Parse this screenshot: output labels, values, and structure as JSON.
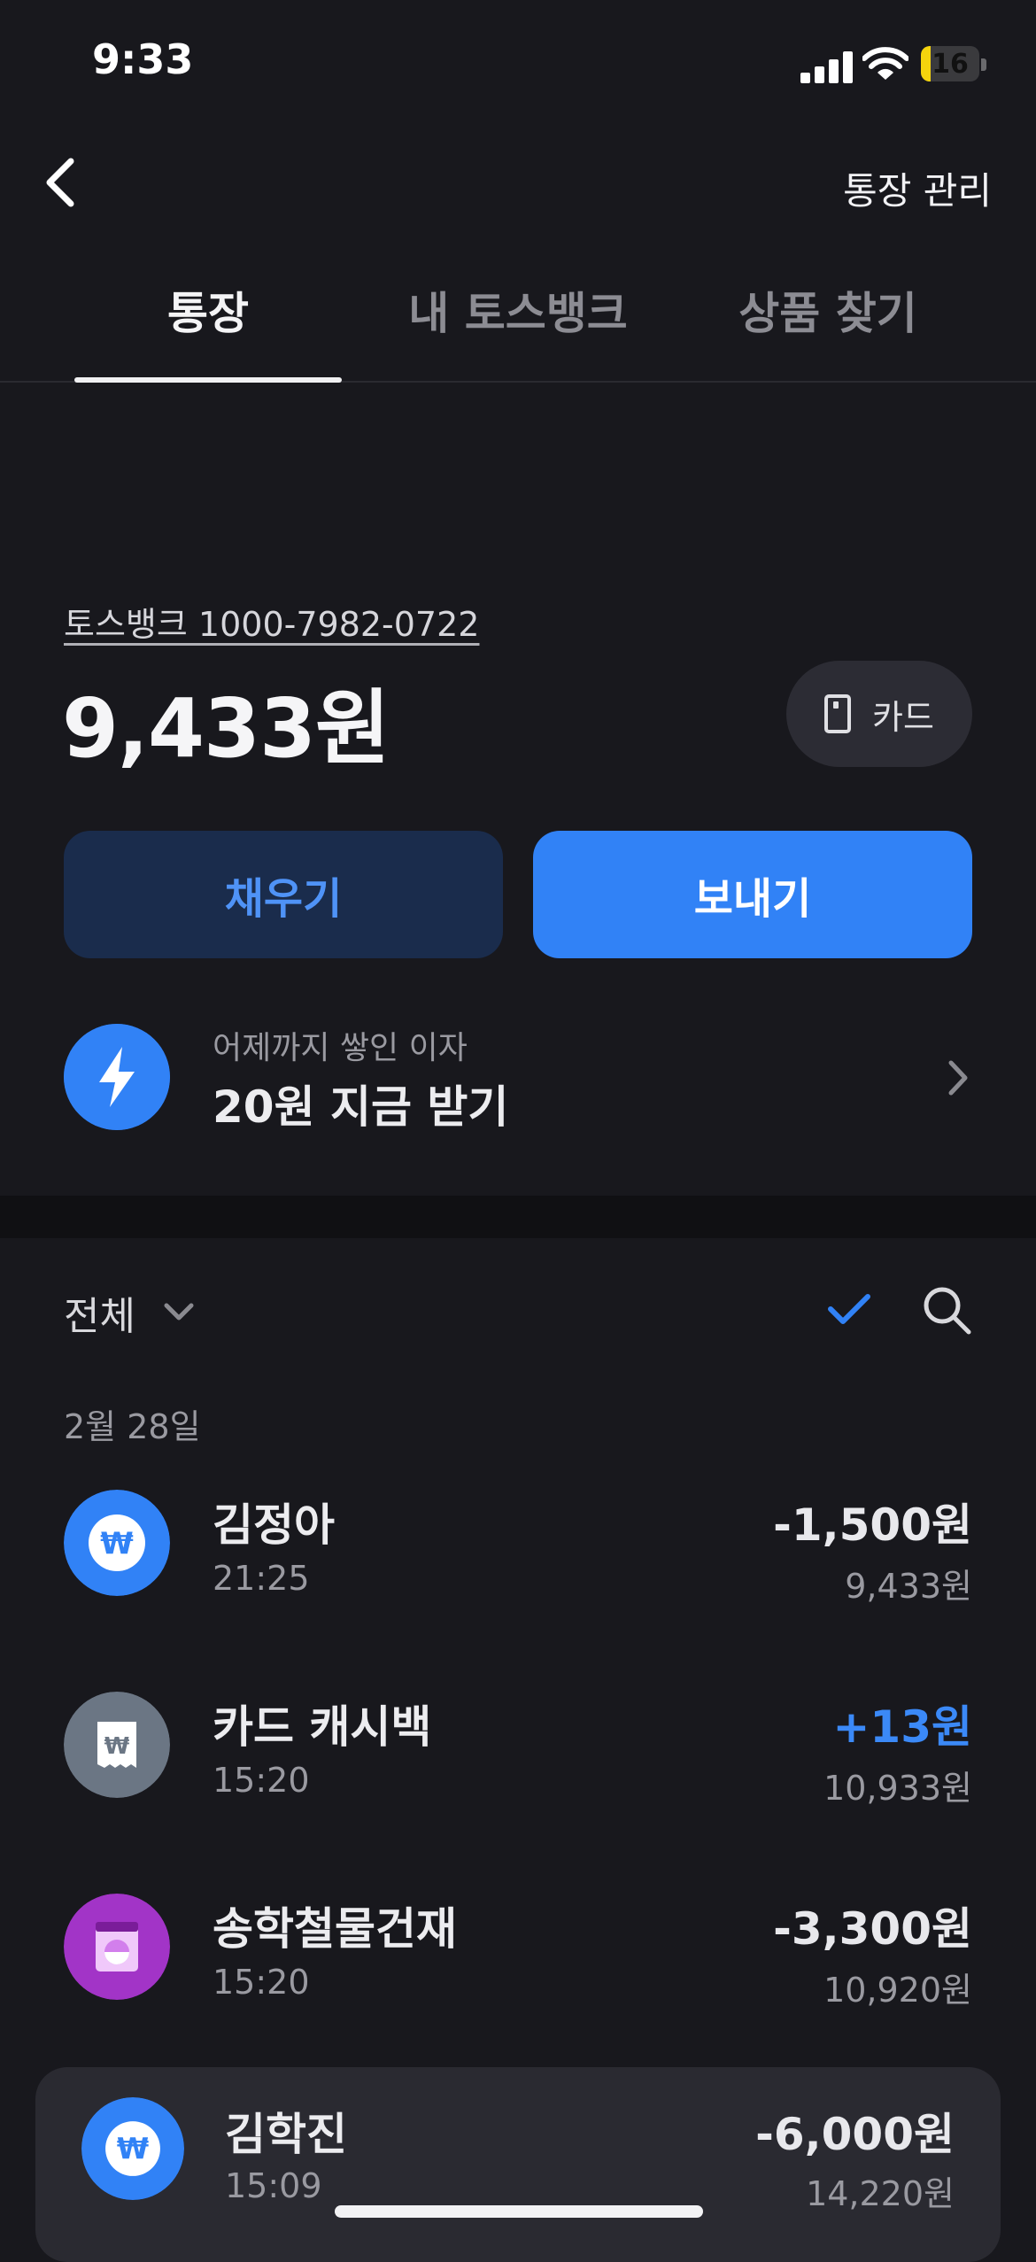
{
  "status_bar": {
    "time": "9:33",
    "battery": "16",
    "battery_level": 0.16
  },
  "header": {
    "manage_label": "통장 관리"
  },
  "tabs": [
    {
      "label": "통장",
      "active": true
    },
    {
      "label": "내 토스뱅크",
      "active": false
    },
    {
      "label": "상품 찾기",
      "active": false
    }
  ],
  "account": {
    "link": "토스뱅크 1000-7982-0722",
    "balance": "9,433원",
    "card_label": "카드",
    "fill_label": "채우기",
    "send_label": "보내기"
  },
  "interest": {
    "sub": "어제까지 쌓인 이자",
    "main": "20원 지금 받기"
  },
  "filter": {
    "label": "전체"
  },
  "date_header": "2월 28일",
  "transactions": [
    {
      "name": "김정아",
      "time": "21:25",
      "amount": "-1,500원",
      "balance": "9,433원",
      "icon": "won-icon",
      "icon_color": "#3182f6"
    },
    {
      "name": "카드 캐시백",
      "time": "15:20",
      "amount": "+13원",
      "balance": "10,933원",
      "icon": "receipt-won-icon",
      "icon_color": "#6b7684"
    },
    {
      "name": "송학철물건재",
      "time": "15:20",
      "amount": "-3,300원",
      "balance": "10,920원",
      "icon": "washing-machine-icon",
      "icon_color": "#a234c7"
    },
    {
      "name": "김학진",
      "time": "15:09",
      "amount": "-6,000원",
      "balance": "14,220원",
      "icon": "won-icon",
      "icon_color": "#3182f6"
    }
  ],
  "colors": {
    "background": "#18181d",
    "accent": "#3182f6",
    "positive": "#3b89f7"
  }
}
